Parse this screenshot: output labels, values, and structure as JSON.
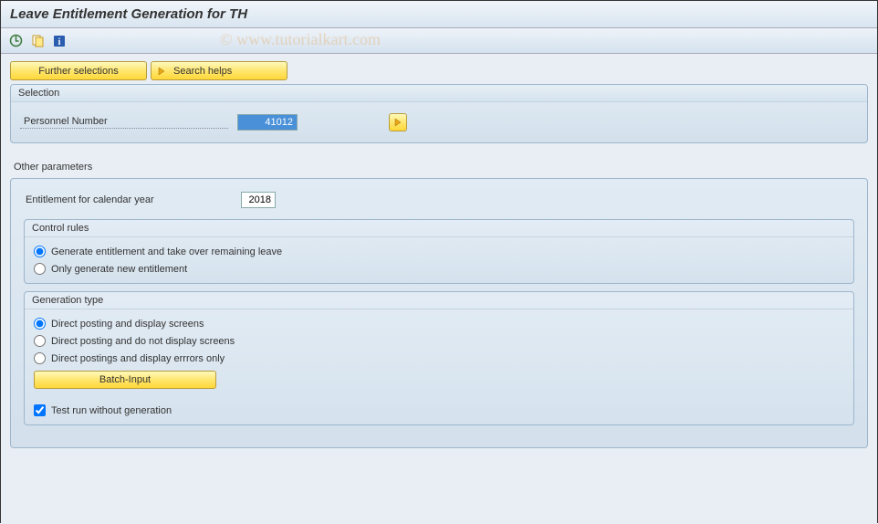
{
  "title": "Leave Entitlement Generation for TH",
  "watermark": "© www.tutorialkart.com",
  "toolbar": {
    "execute_icon": "execute-icon",
    "variant_icon": "variant-icon",
    "info_icon": "info-icon"
  },
  "buttons": {
    "further_selections": "Further selections",
    "search_helps": "Search helps"
  },
  "selection": {
    "header": "Selection",
    "personnel_number_label": "Personnel Number",
    "personnel_number_value": "41012"
  },
  "other_params": {
    "header": "Other parameters",
    "entitlement_year_label": "Entitlement for calendar year",
    "entitlement_year_value": "2018",
    "control_rules": {
      "header": "Control rules",
      "option1": "Generate entitlement and take over remaining leave",
      "option2": "Only generate new entitlement",
      "selected": 0
    },
    "generation_type": {
      "header": "Generation type",
      "option1": "Direct posting and display screens",
      "option2": "Direct posting and do not display screens",
      "option3": "Direct postings and display errrors only",
      "batch_input": "Batch-Input",
      "selected": 0
    },
    "test_run_label": "Test run without generation",
    "test_run_checked": true
  }
}
